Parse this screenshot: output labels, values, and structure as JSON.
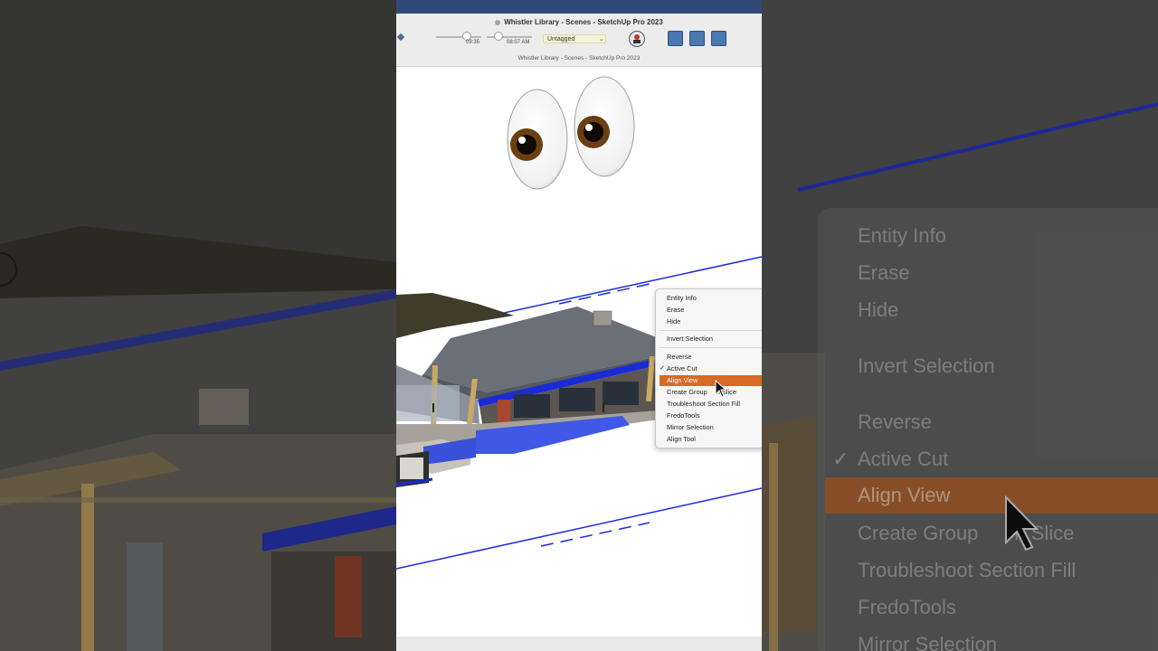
{
  "window": {
    "title": "Whistler Library - Scenes - SketchUp Pro 2023",
    "subtitle": "Whistler Library - Scenes - SketchUp Pro 2023"
  },
  "toolbar": {
    "time_left": "09:35",
    "time_right": "08:07 AM",
    "tag_selected": "Untagged"
  },
  "overlay": {
    "emoji_icon": "eyes-emoji-icon"
  },
  "context_menu": {
    "items": [
      "Entity Info",
      "Erase",
      "Hide",
      "Invert Selection",
      "Reverse",
      "Active Cut",
      "Align View",
      "Create Group from Slice",
      "Troubleshoot Section Fill",
      "FredoTools",
      "Mirror Selection",
      "Align Tool"
    ],
    "highlighted": "Align View",
    "checked": "Active Cut",
    "visible_create_group_left": "Create Group",
    "visible_create_group_right": "n Slice"
  },
  "zoomed_menu": {
    "items": [
      "Entity Info",
      "Erase",
      "Hide",
      "Invert Selection",
      "Reverse",
      "Active Cut",
      "Align View",
      "Create Group",
      "n Slice",
      "Troubleshoot Section Fill",
      "FredoTools",
      "Mirror Selection"
    ]
  },
  "colors": {
    "section_blue": "#1a2bd6",
    "highlight_orange": "#d86a25",
    "window_title_strip": "#2f4a78"
  }
}
